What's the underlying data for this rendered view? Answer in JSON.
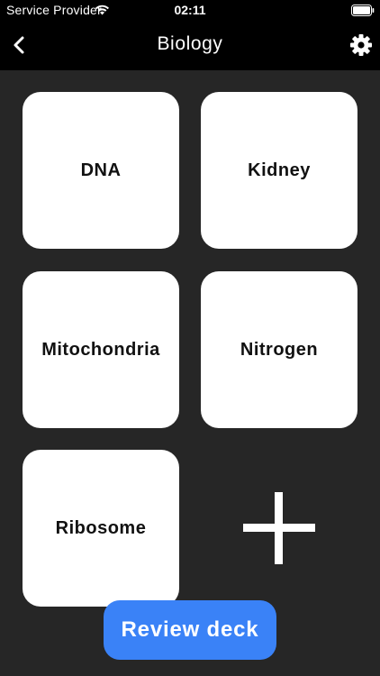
{
  "status_bar": {
    "carrier": "Service Provider",
    "time": "02:11",
    "wifi_icon": "wifi-icon",
    "battery_icon": "battery-icon"
  },
  "nav": {
    "title": "Biology",
    "back_icon": "chevron-left-icon",
    "settings_icon": "gear-icon"
  },
  "deck": {
    "cards": [
      {
        "label": "DNA"
      },
      {
        "label": "Kidney"
      },
      {
        "label": "Mitochondria"
      },
      {
        "label": "Nitrogen"
      },
      {
        "label": "Ribosome"
      }
    ],
    "add_icon": "plus-icon"
  },
  "actions": {
    "review_label": "Review deck"
  },
  "colors": {
    "background": "#262626",
    "bar": "#000000",
    "card": "#ffffff",
    "accent": "#3a82f7"
  }
}
